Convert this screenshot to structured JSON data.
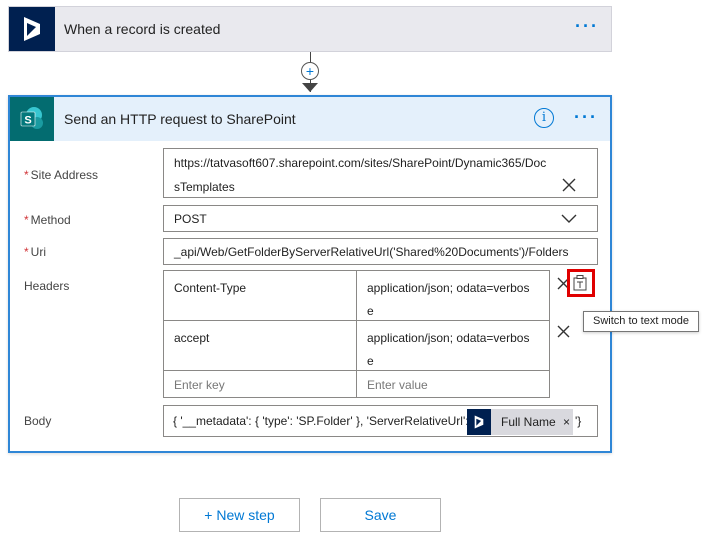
{
  "trigger": {
    "title": "When a record is created",
    "more": "···"
  },
  "connector": {
    "add_label": "+"
  },
  "action": {
    "title": "Send an HTTP request to SharePoint",
    "info": "i",
    "more": "···",
    "site_address": {
      "label": "Site Address",
      "required": "*",
      "value_line1": "https://tatvasoft607.sharepoint.com/sites/SharePoint/Dynamic365/Doc",
      "value_line2": "sTemplates"
    },
    "method": {
      "label": "Method",
      "required": "*",
      "value": "POST"
    },
    "uri": {
      "label": "Uri",
      "required": "*",
      "value": "_api/Web/GetFolderByServerRelativeUrl('Shared%20Documents')/Folders"
    },
    "headers": {
      "label": "Headers",
      "rows": [
        {
          "key": "Content-Type",
          "value_line1": "application/json; odata=verbos",
          "value_line2": "e"
        },
        {
          "key": "accept",
          "value_line1": "application/json; odata=verbos",
          "value_line2": "e"
        }
      ],
      "key_placeholder": "Enter key",
      "value_placeholder": "Enter value",
      "tooltip": "Switch to text mode"
    },
    "body": {
      "label": "Body",
      "value_prefix": "{ '__metadata': { 'type': 'SP.Folder' }, 'ServerRelativeUrl':'",
      "token_name": "Full Name",
      "token_remove": "×",
      "value_suffix": "'}"
    }
  },
  "footer": {
    "new_step": "+ New step",
    "save": "Save"
  },
  "colors": {
    "accent": "#0078d4",
    "dynamics_navy": "#002050",
    "sharepoint_teal": "#036c70",
    "highlight_red": "#e00000"
  }
}
